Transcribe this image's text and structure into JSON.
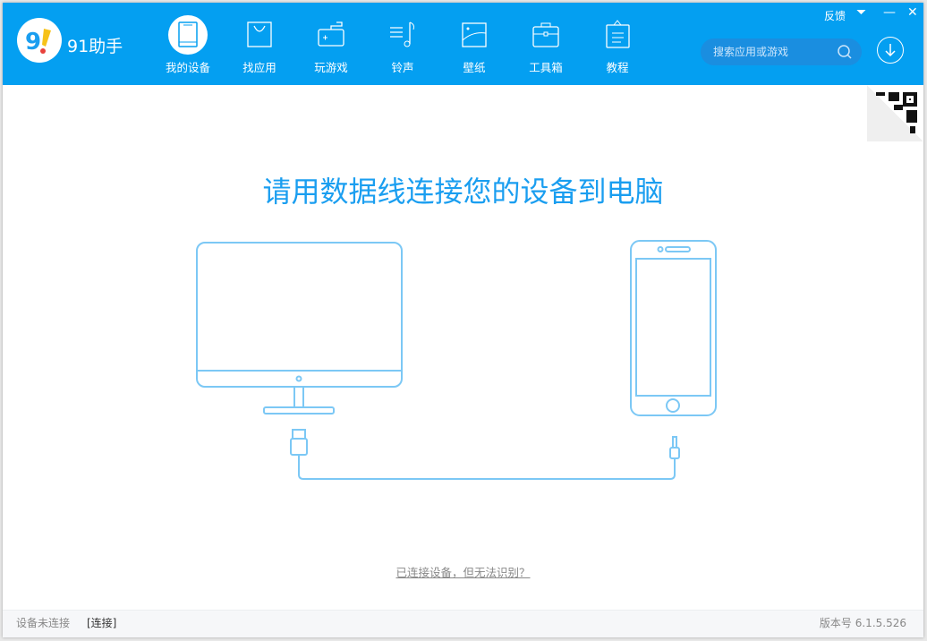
{
  "app": {
    "name": "91助手"
  },
  "nav": [
    {
      "label": "我的设备",
      "active": true
    },
    {
      "label": "找应用"
    },
    {
      "label": "玩游戏"
    },
    {
      "label": "铃声"
    },
    {
      "label": "壁纸"
    },
    {
      "label": "工具箱"
    },
    {
      "label": "教程"
    }
  ],
  "search": {
    "placeholder": "搜索应用或游戏"
  },
  "window": {
    "feedback": "反馈",
    "minimize": "—",
    "close": "✕"
  },
  "main": {
    "title": "请用数据线连接您的设备到电脑",
    "help_link": "已连接设备，但无法识别？"
  },
  "status": {
    "state": "设备未连接",
    "connect": "[连接]",
    "version": "版本号 6.1.5.526"
  },
  "colors": {
    "brand": "#049ff1",
    "illustration": "#7cc8f5"
  }
}
